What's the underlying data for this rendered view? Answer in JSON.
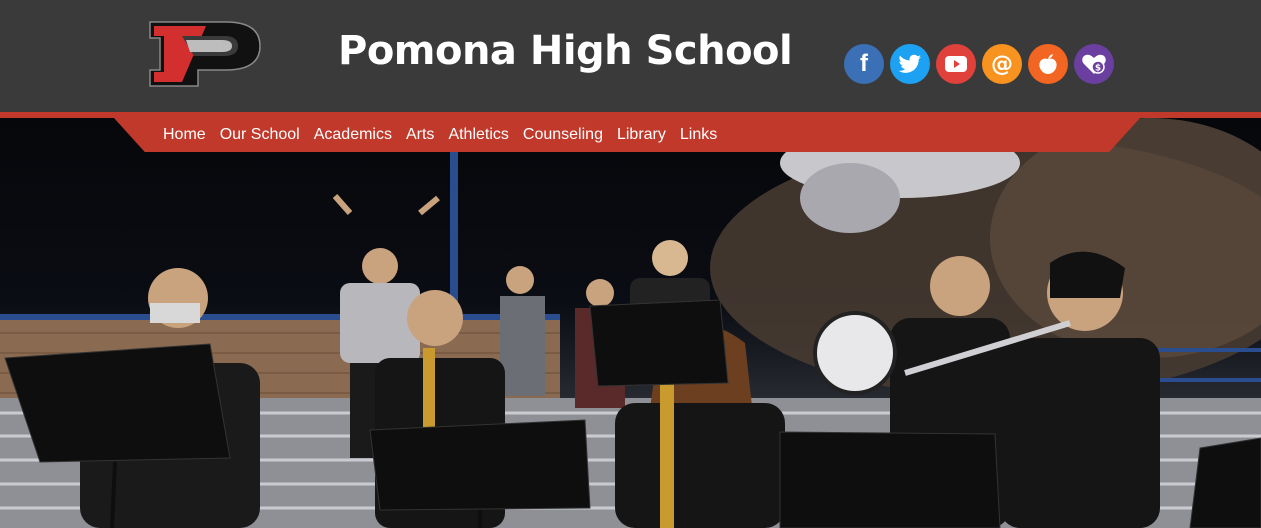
{
  "header": {
    "title": "Pomona High School",
    "logo_icon": "pomona-p-logo",
    "colors": {
      "header_bg": "#3a3a3a",
      "accent_red": "#c0392b"
    }
  },
  "social": [
    {
      "name": "facebook",
      "icon": "facebook-icon",
      "glyph": "f",
      "color": "#3b6fb6"
    },
    {
      "name": "twitter",
      "icon": "twitter-icon",
      "glyph": "",
      "color": "#1da1f2"
    },
    {
      "name": "youtube",
      "icon": "youtube-icon",
      "glyph": "",
      "color": "#e0413b"
    },
    {
      "name": "email",
      "icon": "at-sign-icon",
      "glyph": "@",
      "color": "#f7931e"
    },
    {
      "name": "peachjar",
      "icon": "peach-icon",
      "glyph": "",
      "color": "#f26522"
    },
    {
      "name": "donate",
      "icon": "heart-dollar-icon",
      "glyph": "",
      "color": "#6b3fa0"
    }
  ],
  "nav": {
    "items": [
      {
        "label": "Home"
      },
      {
        "label": "Our School"
      },
      {
        "label": "Academics"
      },
      {
        "label": "Arts"
      },
      {
        "label": "Athletics"
      },
      {
        "label": "Counseling"
      },
      {
        "label": "Library"
      },
      {
        "label": "Links"
      }
    ]
  },
  "hero": {
    "description_icon": "band-photo"
  }
}
